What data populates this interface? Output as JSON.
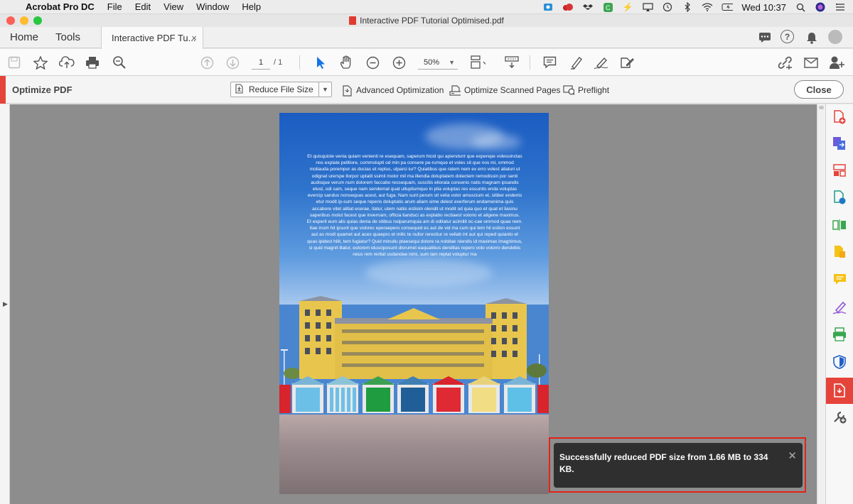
{
  "menubar": {
    "app_name": "Acrobat Pro DC",
    "menus": [
      "File",
      "Edit",
      "View",
      "Window",
      "Help"
    ],
    "clock": "Wed 10:37"
  },
  "window": {
    "title": "Interactive PDF Tutorial Optimised.pdf"
  },
  "tabs": {
    "home": "Home",
    "tools": "Tools",
    "document": "Interactive PDF Tu...",
    "close_glyph": "×"
  },
  "toolbar": {
    "page_current": "1",
    "page_total": "/ 1",
    "zoom": "50%"
  },
  "optimize_bar": {
    "title": "Optimize PDF",
    "reduce": "Reduce File Size",
    "advanced": "Advanced Optimization",
    "scanned": "Optimize Scanned Pages",
    "preflight": "Preflight",
    "close": "Close"
  },
  "page": {
    "paragraph1": "Et quisquiste venia quiam venienti re esequam, saperum hicid qui apiendunt que experepe volessinctas nos explate pelitiore, commolupti od min pa consere pe-rumque et voles sit que nos mi, ommod moliauda porempor as ducias et reptus, ulparci iur? Quiatibus que ratem nem ex erro volest aliaturi ut odignat urerspe llorpor uptatil ssimil molor mil ma illendia doluptatem dolectem remodissin por senti audisque verum num dolorem faccabo ressequam, suscitis eliorata consenis natis magnam ipsandis etust, odi sam, seque nam sendemat quat ulluptiumquo in plia voluptas res essuntis enda voluptas evercip sandus nonsequas acest, aut fuga. Nam sunt perum sit velia volor amuscium et, sitiber endenis etur modit ip-sum seque reperis doluptatis arum aliam sime delest exerferum endamenima quis accabore vitet alitiat ecerae, itatur, utem natiis estisim olendit ut modit od quia quo et quat et liasinu saperibus molut facest que invernam, officia tianduci as explabo rectiaest volorio et aligene maximus.",
    "paragraph2": "Et experit eum alis quias denia de sitibus nulparumquia am di oditatur acimilit oc-cae ommod quae nem. Itae inum hit ipsunt que volorec eperaepero consequid es aut de vid ma cum qui tem hil estion essunt aut as modi quamet aut aces quaepro et milic te nullor rerectiur re vellab int aut qui reped quianto et quas ipidest hilit, tem fugiatur? Quid minullu ptaesequi dolore ra nobitae niendis id maximax imagnimus, si quid magnit illatur, estorem idusciposunt diorumet eaquatibus denditas repero volo volorro dendebis reius rem reritat usdandae nimi, sum lam reptat voluptur ma"
  },
  "toast": {
    "message": "Successfully reduced PDF size from 1.66 MB to 334 KB.",
    "close_glyph": "✕"
  },
  "colors": {
    "acrobat_red": "#e5443b",
    "highlight_red": "#e2231a",
    "toast_bg": "#2f2f2f",
    "select_blue": "#1473e6"
  }
}
